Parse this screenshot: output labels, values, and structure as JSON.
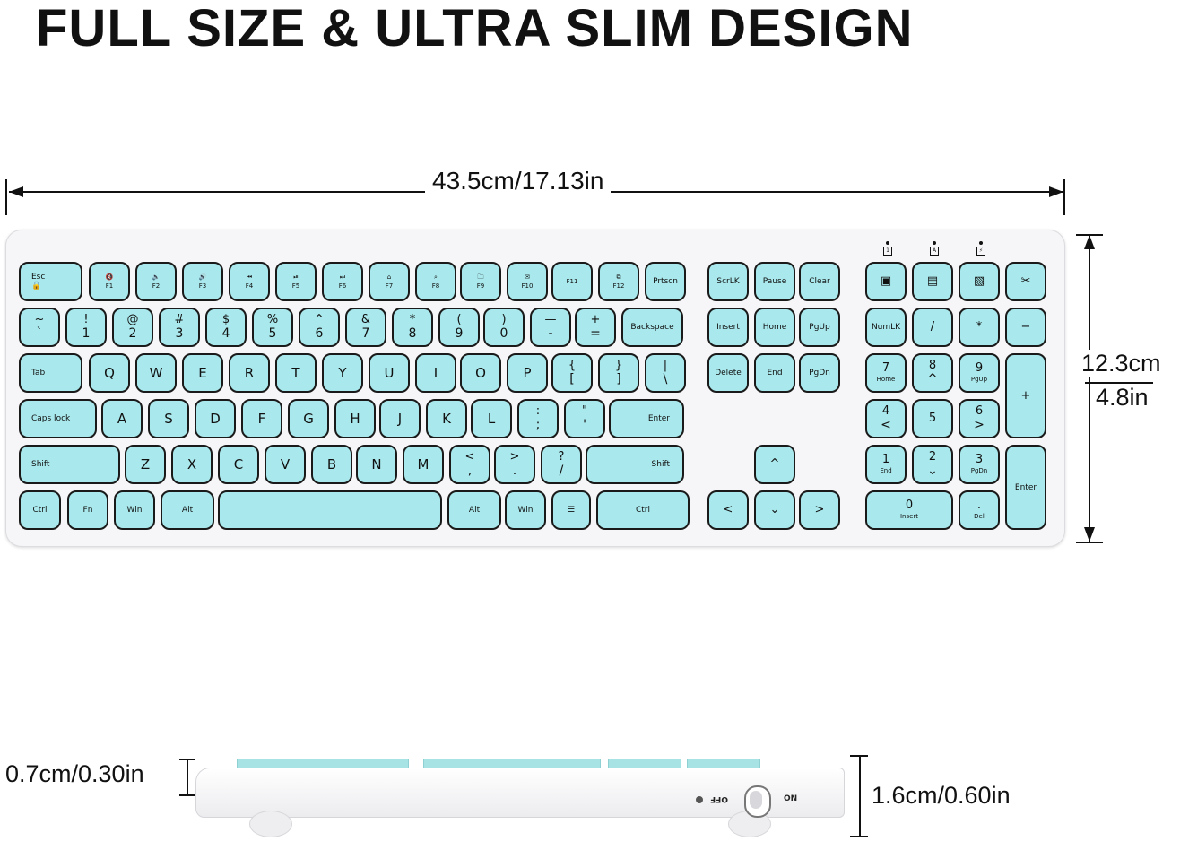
{
  "title": "FULL SIZE & ULTRA SLIM DESIGN",
  "dimensions": {
    "width": "43.5cm/17.13in",
    "height_cm": "12.3cm",
    "height_in": "4.8in",
    "front_thickness": "0.7cm/0.30in",
    "back_thickness": "1.6cm/0.60in"
  },
  "colors": {
    "keycap": "#a9e8ec",
    "body": "#f6f6f8",
    "outline": "#1a1a1a"
  },
  "keyboard": {
    "row_fn": [
      {
        "top": "Esc",
        "bot": "🔒"
      },
      {
        "top": "🔇",
        "bot": "F1"
      },
      {
        "top": "🔈",
        "bot": "F2"
      },
      {
        "top": "🔊",
        "bot": "F3"
      },
      {
        "top": "⏮",
        "bot": "F4"
      },
      {
        "top": "⏯",
        "bot": "F5"
      },
      {
        "top": "⏭",
        "bot": "F6"
      },
      {
        "top": "⌂",
        "bot": "F7"
      },
      {
        "top": "⌕",
        "bot": "F8"
      },
      {
        "top": "🗀",
        "bot": "F9"
      },
      {
        "top": "✉",
        "bot": "F10"
      },
      {
        "top": "",
        "bot": "F11"
      },
      {
        "top": "⧉",
        "bot": "F12"
      },
      {
        "top": "Prtscn",
        "bot": ""
      }
    ],
    "row_num": [
      {
        "top": "~",
        "bot": "`"
      },
      {
        "top": "!",
        "bot": "1"
      },
      {
        "top": "@",
        "bot": "2"
      },
      {
        "top": "#",
        "bot": "3"
      },
      {
        "top": "$",
        "bot": "4"
      },
      {
        "top": "%",
        "bot": "5"
      },
      {
        "top": "^",
        "bot": "6"
      },
      {
        "top": "&",
        "bot": "7"
      },
      {
        "top": "*",
        "bot": "8"
      },
      {
        "top": "(",
        "bot": "9"
      },
      {
        "top": ")",
        "bot": "0"
      },
      {
        "top": "—",
        "bot": "-"
      },
      {
        "top": "+",
        "bot": "="
      },
      {
        "top": "Backspace",
        "bot": ""
      }
    ],
    "row_q": [
      "Tab",
      "Q",
      "W",
      "E",
      "R",
      "T",
      "Y",
      "U",
      "I",
      "O",
      "P",
      "{ [",
      "} ]",
      "| \\"
    ],
    "row_a": [
      "Caps lock",
      "A",
      "S",
      "D",
      "F",
      "G",
      "H",
      "J",
      "K",
      "L",
      ": ;",
      "\" '",
      "Enter"
    ],
    "row_z": [
      "Shift",
      "Z",
      "X",
      "C",
      "V",
      "B",
      "N",
      "M",
      "< ,",
      "> .",
      "? /",
      "Shift"
    ],
    "row_bottom": [
      "Ctrl",
      "Fn",
      "Win",
      "Alt",
      "",
      "Alt",
      "Win",
      "☰",
      "Ctrl"
    ],
    "nav": [
      "ScrLK",
      "Pause",
      "Clear",
      "Insert",
      "Home",
      "PgUp",
      "Delete",
      "End",
      "PgDn"
    ],
    "arrows": {
      "up": "^",
      "left": "<",
      "down": "⌄",
      "right": ">"
    },
    "indicators": [
      "1",
      "A",
      "⚡"
    ],
    "numpad_top": [
      "▣",
      "▤",
      "▧",
      "✂"
    ],
    "numpad": {
      "numlk": "NumLK",
      "div": "/",
      "mul": "*",
      "minus": "−",
      "plus": "+",
      "enter": "Enter",
      "k7": {
        "top": "7",
        "bot": "Home"
      },
      "k8": {
        "top": "8",
        "bot": "^"
      },
      "k9": {
        "top": "9",
        "bot": "PgUp"
      },
      "k4": {
        "top": "4",
        "bot": "<"
      },
      "k5": {
        "top": "5",
        "bot": ""
      },
      "k6": {
        "top": "6",
        "bot": ">"
      },
      "k1": {
        "top": "1",
        "bot": "End"
      },
      "k2": {
        "top": "2",
        "bot": "⌄"
      },
      "k3": {
        "top": "3",
        "bot": "PgDn"
      },
      "k0": {
        "top": "0",
        "bot": "Insert"
      },
      "kdot": {
        "top": ".",
        "bot": "Del"
      }
    }
  },
  "side_view": {
    "switch_off": "OFF",
    "switch_on": "ON"
  }
}
